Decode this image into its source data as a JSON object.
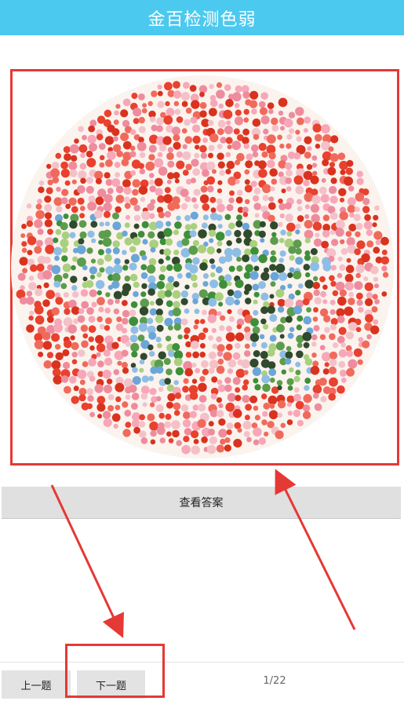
{
  "header": {
    "title": "金百检测色弱"
  },
  "plate": {
    "description_icon": "color-blindness-test-plate",
    "colors": {
      "background_dots": [
        "#e8412e",
        "#f06a5c",
        "#f7a7b8",
        "#ee8c9e",
        "#d9331f",
        "#f4c1c9"
      ],
      "figure_dots": [
        "#3d8f3a",
        "#5b9d4d",
        "#2f4a2c",
        "#8ebee5",
        "#a9d07f",
        "#6aa6d8"
      ]
    }
  },
  "answer_button": {
    "label": "查看答案"
  },
  "nav": {
    "prev_label": "上一题",
    "next_label": "下一题",
    "page_indicator": "1/22"
  },
  "annotations": {
    "highlight_color": "#e53935"
  }
}
